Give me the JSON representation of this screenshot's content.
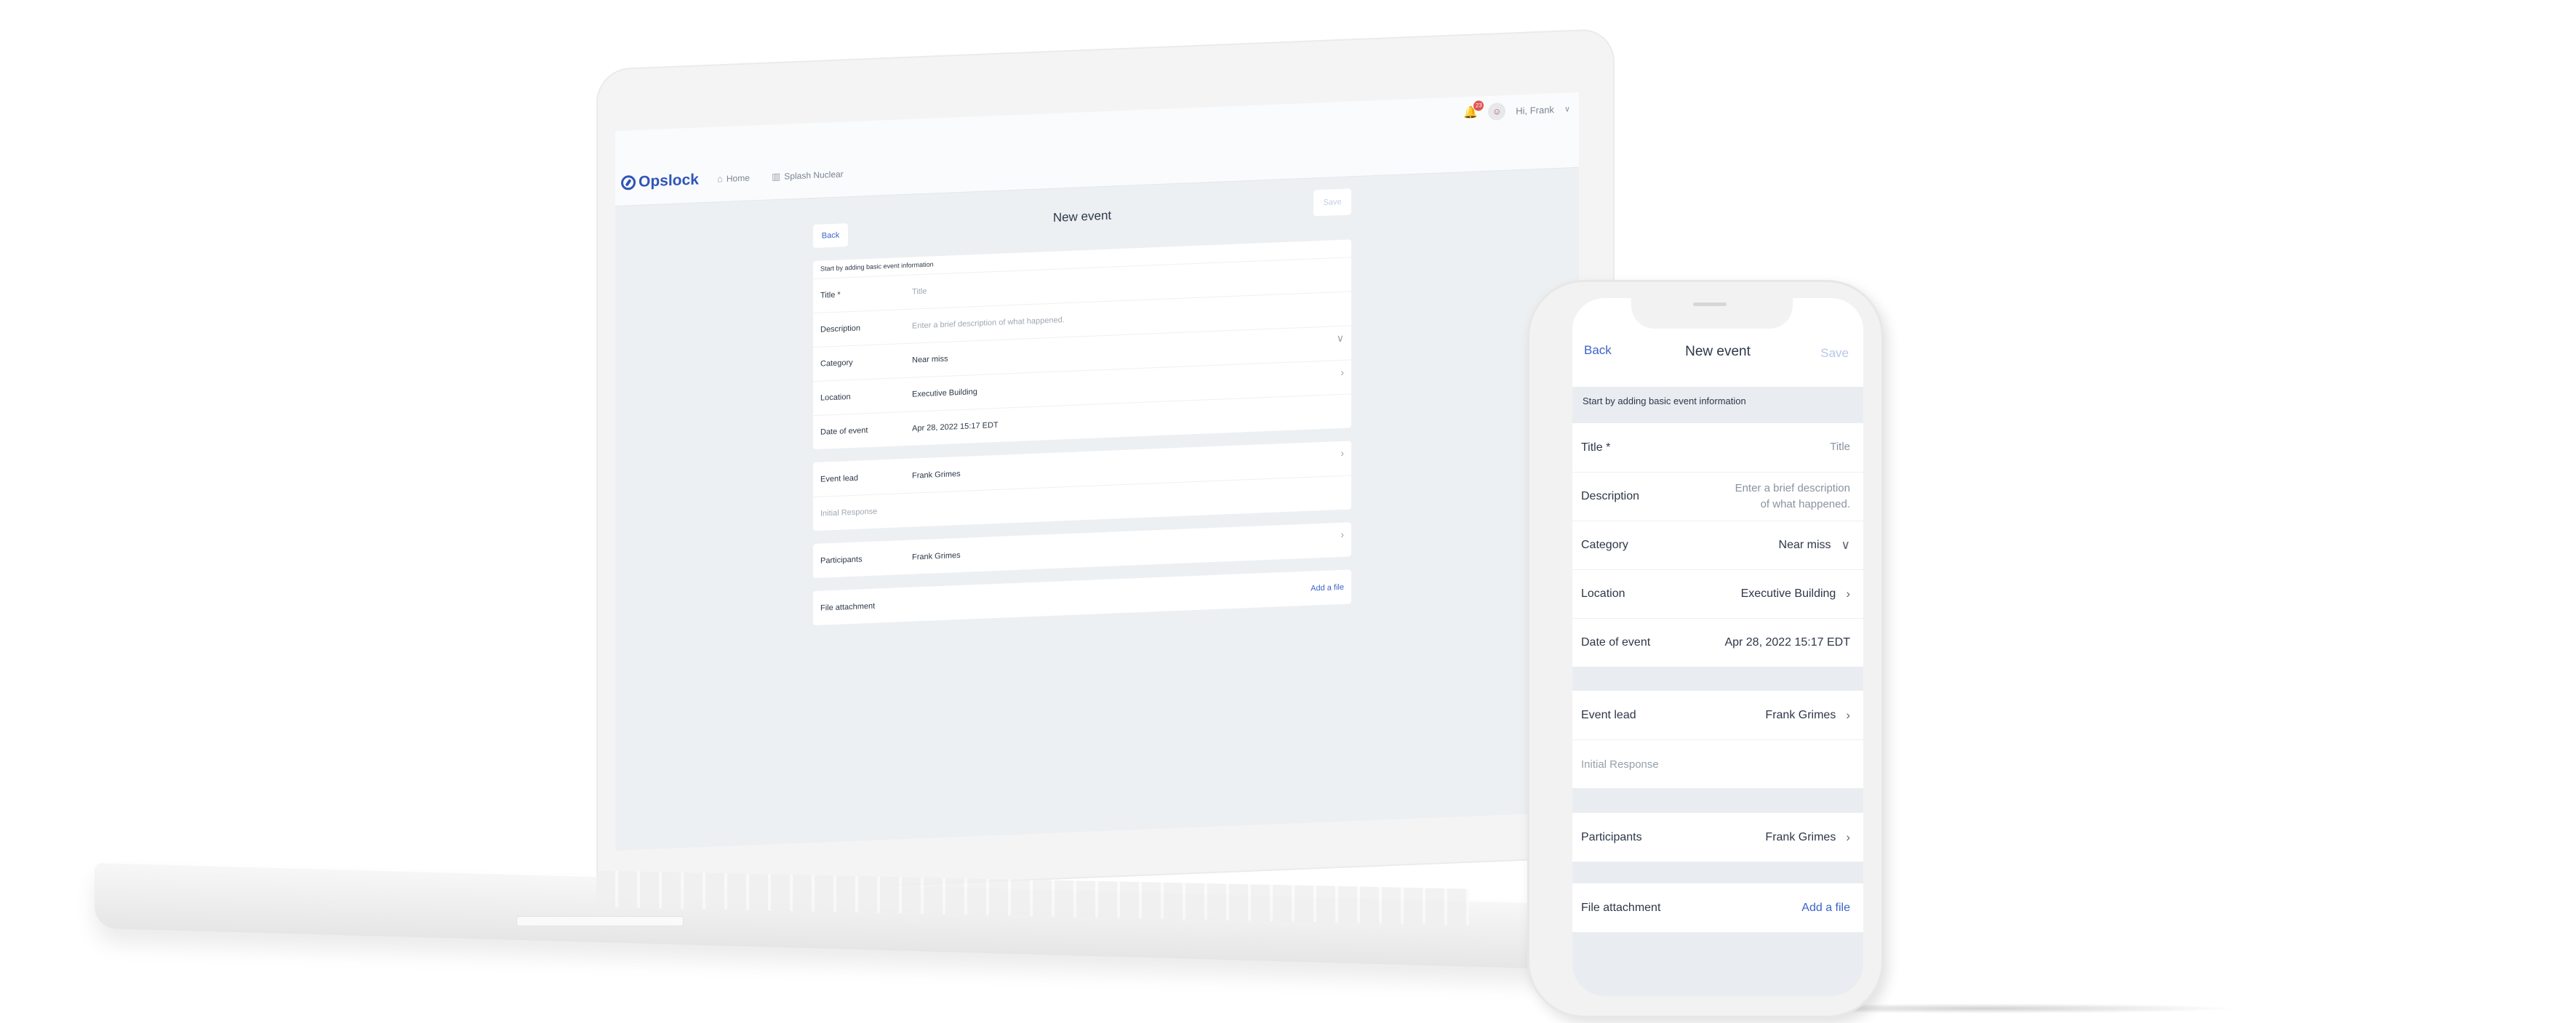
{
  "laptop": {
    "app": {
      "logo": "Opslock",
      "nav": [
        {
          "label": "Home",
          "icon": "home-icon"
        },
        {
          "label": "Splash Nuclear",
          "icon": "building-icon"
        }
      ],
      "notifications_count": "23",
      "greeting": "Hi, Frank"
    },
    "page": {
      "back_label": "Back",
      "title": "New event",
      "save_label": "Save",
      "hint": "Start by adding basic event information",
      "fields": [
        {
          "label": "Title *",
          "value": "Title",
          "placeholder": true
        },
        {
          "label": "Description",
          "value": "Enter a brief description of what happened.",
          "placeholder": true
        },
        {
          "label": "Category",
          "value": "Near miss",
          "icon": "chevron-down-icon"
        },
        {
          "label": "Location",
          "value": "Executive Building",
          "icon": "chevron-right-icon"
        },
        {
          "label": "Date of event",
          "value": "Apr 28, 2022 15:17 EDT"
        }
      ],
      "event_lead": {
        "label": "Event lead",
        "value": "Frank Grimes"
      },
      "initial_response": "Initial Response",
      "participants": {
        "label": "Participants",
        "value": "Frank Grimes"
      },
      "file_attachment": {
        "label": "File attachment",
        "action": "Add a file"
      }
    }
  },
  "phone": {
    "back_label": "Back",
    "title": "New event",
    "save_label": "Save",
    "hint": "Start by adding basic event information",
    "fields": [
      {
        "label": "Title *",
        "value": "Title"
      },
      {
        "label": "Description",
        "value_line1": "Enter a brief description",
        "value_line2": "of what happened."
      },
      {
        "label": "Category",
        "value": "Near miss"
      },
      {
        "label": "Location",
        "value": "Executive Building"
      },
      {
        "label": "Date of event",
        "value": "Apr 28, 2022 15:17 EDT"
      }
    ],
    "event_lead": {
      "label": "Event lead",
      "value": "Frank Grimes"
    },
    "initial_response": "Initial Response",
    "participants": {
      "label": "Participants",
      "value": "Frank Grimes"
    },
    "file_attachment": {
      "label": "File attachment",
      "action": "Add a file"
    }
  },
  "colors": {
    "brand": "#2f55b8",
    "link": "#3d63c9",
    "save_disabled": "#b8c6e6",
    "background": "#edf0f3",
    "badge": "#e05252"
  }
}
